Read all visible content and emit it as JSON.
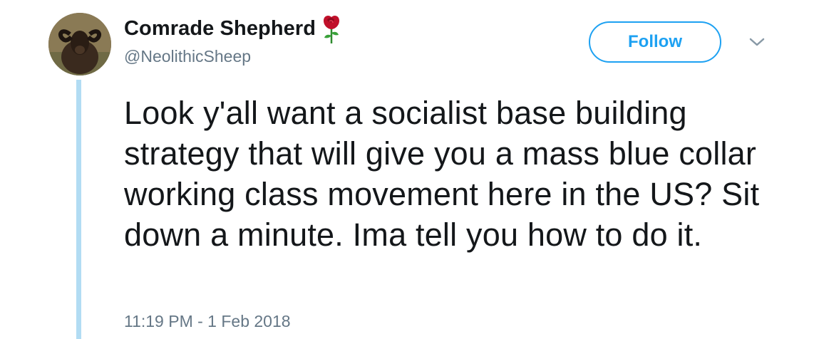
{
  "author": {
    "display_name": "Comrade Shepherd",
    "name_emoji": "rose-icon",
    "handle": "@NeolithicSheep",
    "avatar": "sheep-avatar"
  },
  "actions": {
    "follow_label": "Follow",
    "menu_icon": "chevron-down-icon"
  },
  "tweet": {
    "text": "Look y'all want a socialist base building strategy that will give you a mass blue collar working class movement here in the US? Sit down a minute. Ima tell you how to do it.",
    "timestamp": "11:19 PM - 1 Feb 2018"
  },
  "colors": {
    "accent": "#1da1f2",
    "thread_line": "#b2dcf3",
    "text_primary": "#14171a",
    "text_secondary": "#657786",
    "rose": "#c0102a"
  }
}
